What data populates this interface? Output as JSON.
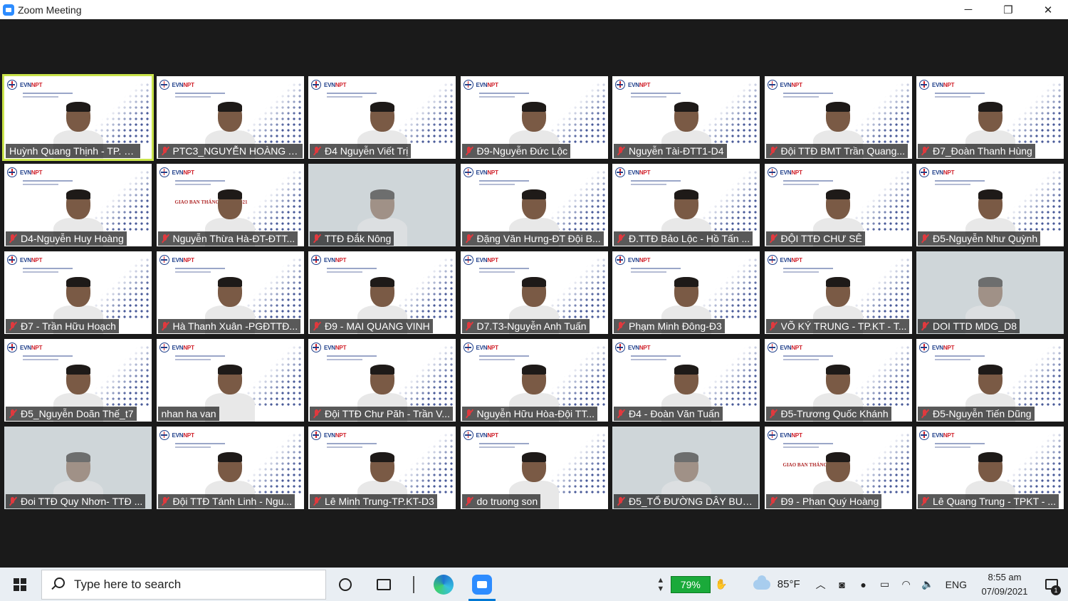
{
  "window": {
    "title": "Zoom Meeting",
    "minimize": "─",
    "restore": "❐",
    "close": "✕"
  },
  "participants": [
    {
      "name": "Huỳnh Quang Thịnh - TP. KT...",
      "active": true,
      "muted": false,
      "bg": "evn"
    },
    {
      "name": "PTC3_NGUYỄN HOÀNG A...",
      "muted": true,
      "bg": "evn"
    },
    {
      "name": "Đ4 Nguyễn Viết Trị",
      "muted": true,
      "bg": "evn"
    },
    {
      "name": "Đ9-Nguyễn Đức Lộc",
      "muted": true,
      "bg": "evn"
    },
    {
      "name": "Nguyễn Tài-ĐTT1-D4",
      "muted": true,
      "bg": "evn"
    },
    {
      "name": "Đội TTĐ BMT Trần Quang...",
      "muted": true,
      "bg": "evn"
    },
    {
      "name": "Đ7_Đoàn Thanh Hùng",
      "muted": true,
      "bg": "evn"
    },
    {
      "name": "D4-Nguyễn Huy Hoàng",
      "muted": true,
      "bg": "evn"
    },
    {
      "name": "Nguyễn Thừa Hà-ĐT-ĐTT...",
      "muted": true,
      "bg": "banner",
      "banner": "GIAO BAN THÁNG 8 NĂM 2021"
    },
    {
      "name": "TTĐ Đắk Nông",
      "muted": true,
      "bg": "room"
    },
    {
      "name": "Đặng Văn Hưng-ĐT Đội B...",
      "muted": true,
      "bg": "evn"
    },
    {
      "name": "Đ.TTĐ Bảo Lộc - Hồ Tấn ...",
      "muted": true,
      "bg": "evn"
    },
    {
      "name": "ĐỘI TTĐ CHƯ SÊ",
      "muted": true,
      "bg": "evn"
    },
    {
      "name": "Đ5-Nguyễn Như Quỳnh",
      "muted": true,
      "bg": "evn"
    },
    {
      "name": "Đ7 - Trần Hữu Hoạch",
      "muted": true,
      "bg": "evn"
    },
    {
      "name": "Hà Thanh Xuân -PGĐTTĐ...",
      "muted": true,
      "bg": "evn"
    },
    {
      "name": "Đ9 - MAI QUANG VINH",
      "muted": true,
      "bg": "evn"
    },
    {
      "name": "D7.T3-Nguyễn Anh Tuấn",
      "muted": true,
      "bg": "evn"
    },
    {
      "name": "Phạm Minh Đông-Đ3",
      "muted": true,
      "bg": "evn"
    },
    {
      "name": "VÕ KÝ TRUNG - TP.KT - T...",
      "muted": true,
      "bg": "evn"
    },
    {
      "name": "DOI TTD MDG_D8",
      "muted": true,
      "bg": "room"
    },
    {
      "name": "Đ5_Nguyễn Doãn Thế_t7",
      "muted": true,
      "bg": "evn"
    },
    {
      "name": "nhan ha van",
      "muted": false,
      "bg": "evn"
    },
    {
      "name": "Đội TTĐ Chư Păh - Trần V...",
      "muted": true,
      "bg": "evn"
    },
    {
      "name": "Nguyễn Hữu Hòa-Đội TT...",
      "muted": true,
      "bg": "evn"
    },
    {
      "name": "Đ4 - Đoàn Văn Tuấn",
      "muted": true,
      "bg": "evn"
    },
    {
      "name": "Đ5-Trương Quốc Khánh",
      "muted": true,
      "bg": "evn"
    },
    {
      "name": "Đ5-Nguyễn Tiến Dũng",
      "muted": true,
      "bg": "evn"
    },
    {
      "name": "Đoi TTĐ Quy Nhơn- TTĐ ...",
      "muted": true,
      "bg": "room"
    },
    {
      "name": "Đội TTĐ Tánh Linh - Ngu...",
      "muted": true,
      "bg": "evn"
    },
    {
      "name": "Lê Minh Trung-TP.KT-D3",
      "muted": true,
      "bg": "evn"
    },
    {
      "name": "do truong son",
      "muted": true,
      "bg": "evn"
    },
    {
      "name": "Đ5_TỔ ĐƯỜNG DÂY BUÔ...",
      "muted": true,
      "bg": "room"
    },
    {
      "name": "Đ9 - Phan Quý Hoàng",
      "muted": true,
      "bg": "banner",
      "banner": "GIAO BAN THÁNG"
    },
    {
      "name": "Lê Quang Trung - TPKT - ...",
      "muted": true,
      "bg": "evn"
    }
  ],
  "taskbar": {
    "search_placeholder": "Type here to search",
    "battery": "79%",
    "temperature": "85°F",
    "language": "ENG",
    "time": "8:55 am",
    "date": "07/09/2021",
    "notification_count": "1"
  },
  "colors": {
    "active_outline": "#c9e34a",
    "muted_mic": "#e0393e",
    "battery_green": "#1aaa3a",
    "zoom_blue": "#2d8cff"
  }
}
